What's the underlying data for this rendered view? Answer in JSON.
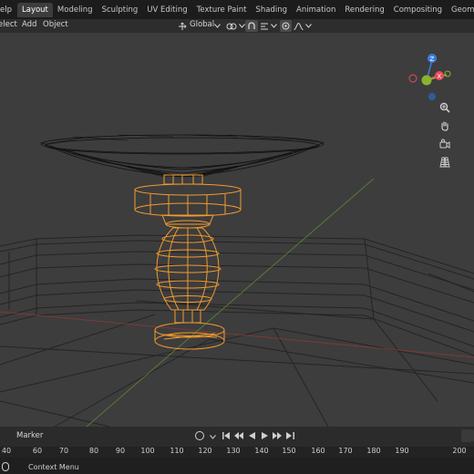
{
  "topbar": {
    "menu_help": "elp",
    "tabs": [
      "Layout",
      "Modeling",
      "Sculpting",
      "UV Editing",
      "Texture Paint",
      "Shading",
      "Animation",
      "Rendering",
      "Compositing",
      "Geometry Nodes"
    ],
    "active_tab": "Layout"
  },
  "header": {
    "select": "elect",
    "add": "Add",
    "object": "Object",
    "orientation": "Global"
  },
  "gizmo": {
    "z_label": "Z",
    "x_label": "X",
    "colors": {
      "x": "#e94b5c",
      "y": "#8ab330",
      "z": "#3b7ddc"
    }
  },
  "nav_icons": [
    "zoom-icon",
    "hand-icon",
    "camera-icon",
    "grid-icon"
  ],
  "timeline": {
    "marker": "Marker"
  },
  "ruler": {
    "ticks": [
      "40",
      "60",
      "70",
      "80",
      "90",
      "100",
      "110",
      "120",
      "130",
      "140",
      "150",
      "160",
      "170",
      "180",
      "190",
      "200"
    ]
  },
  "status": {
    "text": "Context Menu"
  },
  "colors": {
    "selected": "#f29a2e",
    "wire": "#0d0d0d",
    "accent": "#4772b3"
  }
}
